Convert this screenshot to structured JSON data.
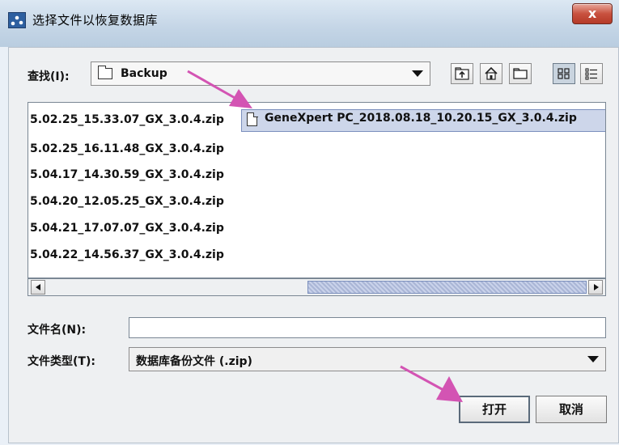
{
  "window": {
    "title": "选择文件以恢复数据库",
    "close_label": "x"
  },
  "toolbar": {
    "lookin_label": "查找(I):",
    "lookin_value": "Backup",
    "buttons": [
      "up-one-level-icon",
      "home-icon",
      "new-folder-icon",
      "list-view-icon",
      "details-view-icon"
    ]
  },
  "files": [
    {
      "name": "5.02.25_15.33.07_GX_3.0.4.zip",
      "selected": false
    },
    {
      "name": "5.02.25_16.11.48_GX_3.0.4.zip",
      "selected": false
    },
    {
      "name": "5.04.17_14.30.59_GX_3.0.4.zip",
      "selected": false
    },
    {
      "name": "5.04.20_12.05.25_GX_3.0.4.zip",
      "selected": false
    },
    {
      "name": "5.04.21_17.07.07_GX_3.0.4.zip",
      "selected": false
    },
    {
      "name": "5.04.22_14.56.37_GX_3.0.4.zip",
      "selected": false
    },
    {
      "name": "GeneXpert PC_2018.08.18_10.20.15_GX_3.0.4.zip",
      "selected": true
    }
  ],
  "form": {
    "filename_label": "文件名(N):",
    "filename_value": "",
    "filetype_label": "文件类型(T):",
    "filetype_value": "数据库备份文件 (.zip)"
  },
  "buttons": {
    "open": "打开",
    "cancel": "取消"
  },
  "colors": {
    "annotation_arrow": "#d354b3",
    "selection": "#cdd6ea",
    "close_button": "#c8513f"
  }
}
